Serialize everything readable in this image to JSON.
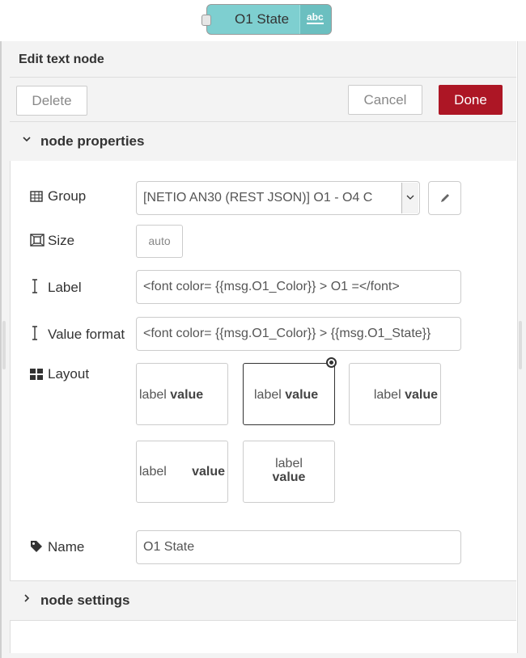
{
  "node": {
    "label": "O1 State",
    "icon_text": "abc"
  },
  "header": {
    "title": "Edit text node"
  },
  "toolbar": {
    "delete_label": "Delete",
    "cancel_label": "Cancel",
    "done_label": "Done"
  },
  "sections": {
    "properties_title": "node properties",
    "settings_title": "node settings"
  },
  "form": {
    "group_label": "Group",
    "group_value": "[NETIO AN30 (REST JSON)] O1 - O4 C",
    "size_label": "Size",
    "size_value": "auto",
    "label_label": "Label",
    "label_value": "<font color= {{msg.O1_Color}} > O1 =</font>",
    "format_label": "Value format",
    "format_value": "<font color= {{msg.O1_Color}} > {{msg.O1_State}}",
    "layout_label": "Layout",
    "layout_options": [
      {
        "label": "label",
        "value": "value"
      },
      {
        "label": "label",
        "value": "value"
      },
      {
        "label": "label",
        "value": "value"
      },
      {
        "label": "label",
        "value": "value"
      },
      {
        "label": "label",
        "value": "value"
      }
    ],
    "name_label": "Name",
    "name_value": "O1 State"
  },
  "colors": {
    "done": "#ad1625",
    "node": "#7ecfd0"
  },
  "icons": [
    "table-icon",
    "resize-icon",
    "text-cursor-icon",
    "grid-icon",
    "tag-icon",
    "pencil-icon",
    "chevron-down-icon",
    "chevron-right-icon"
  ]
}
